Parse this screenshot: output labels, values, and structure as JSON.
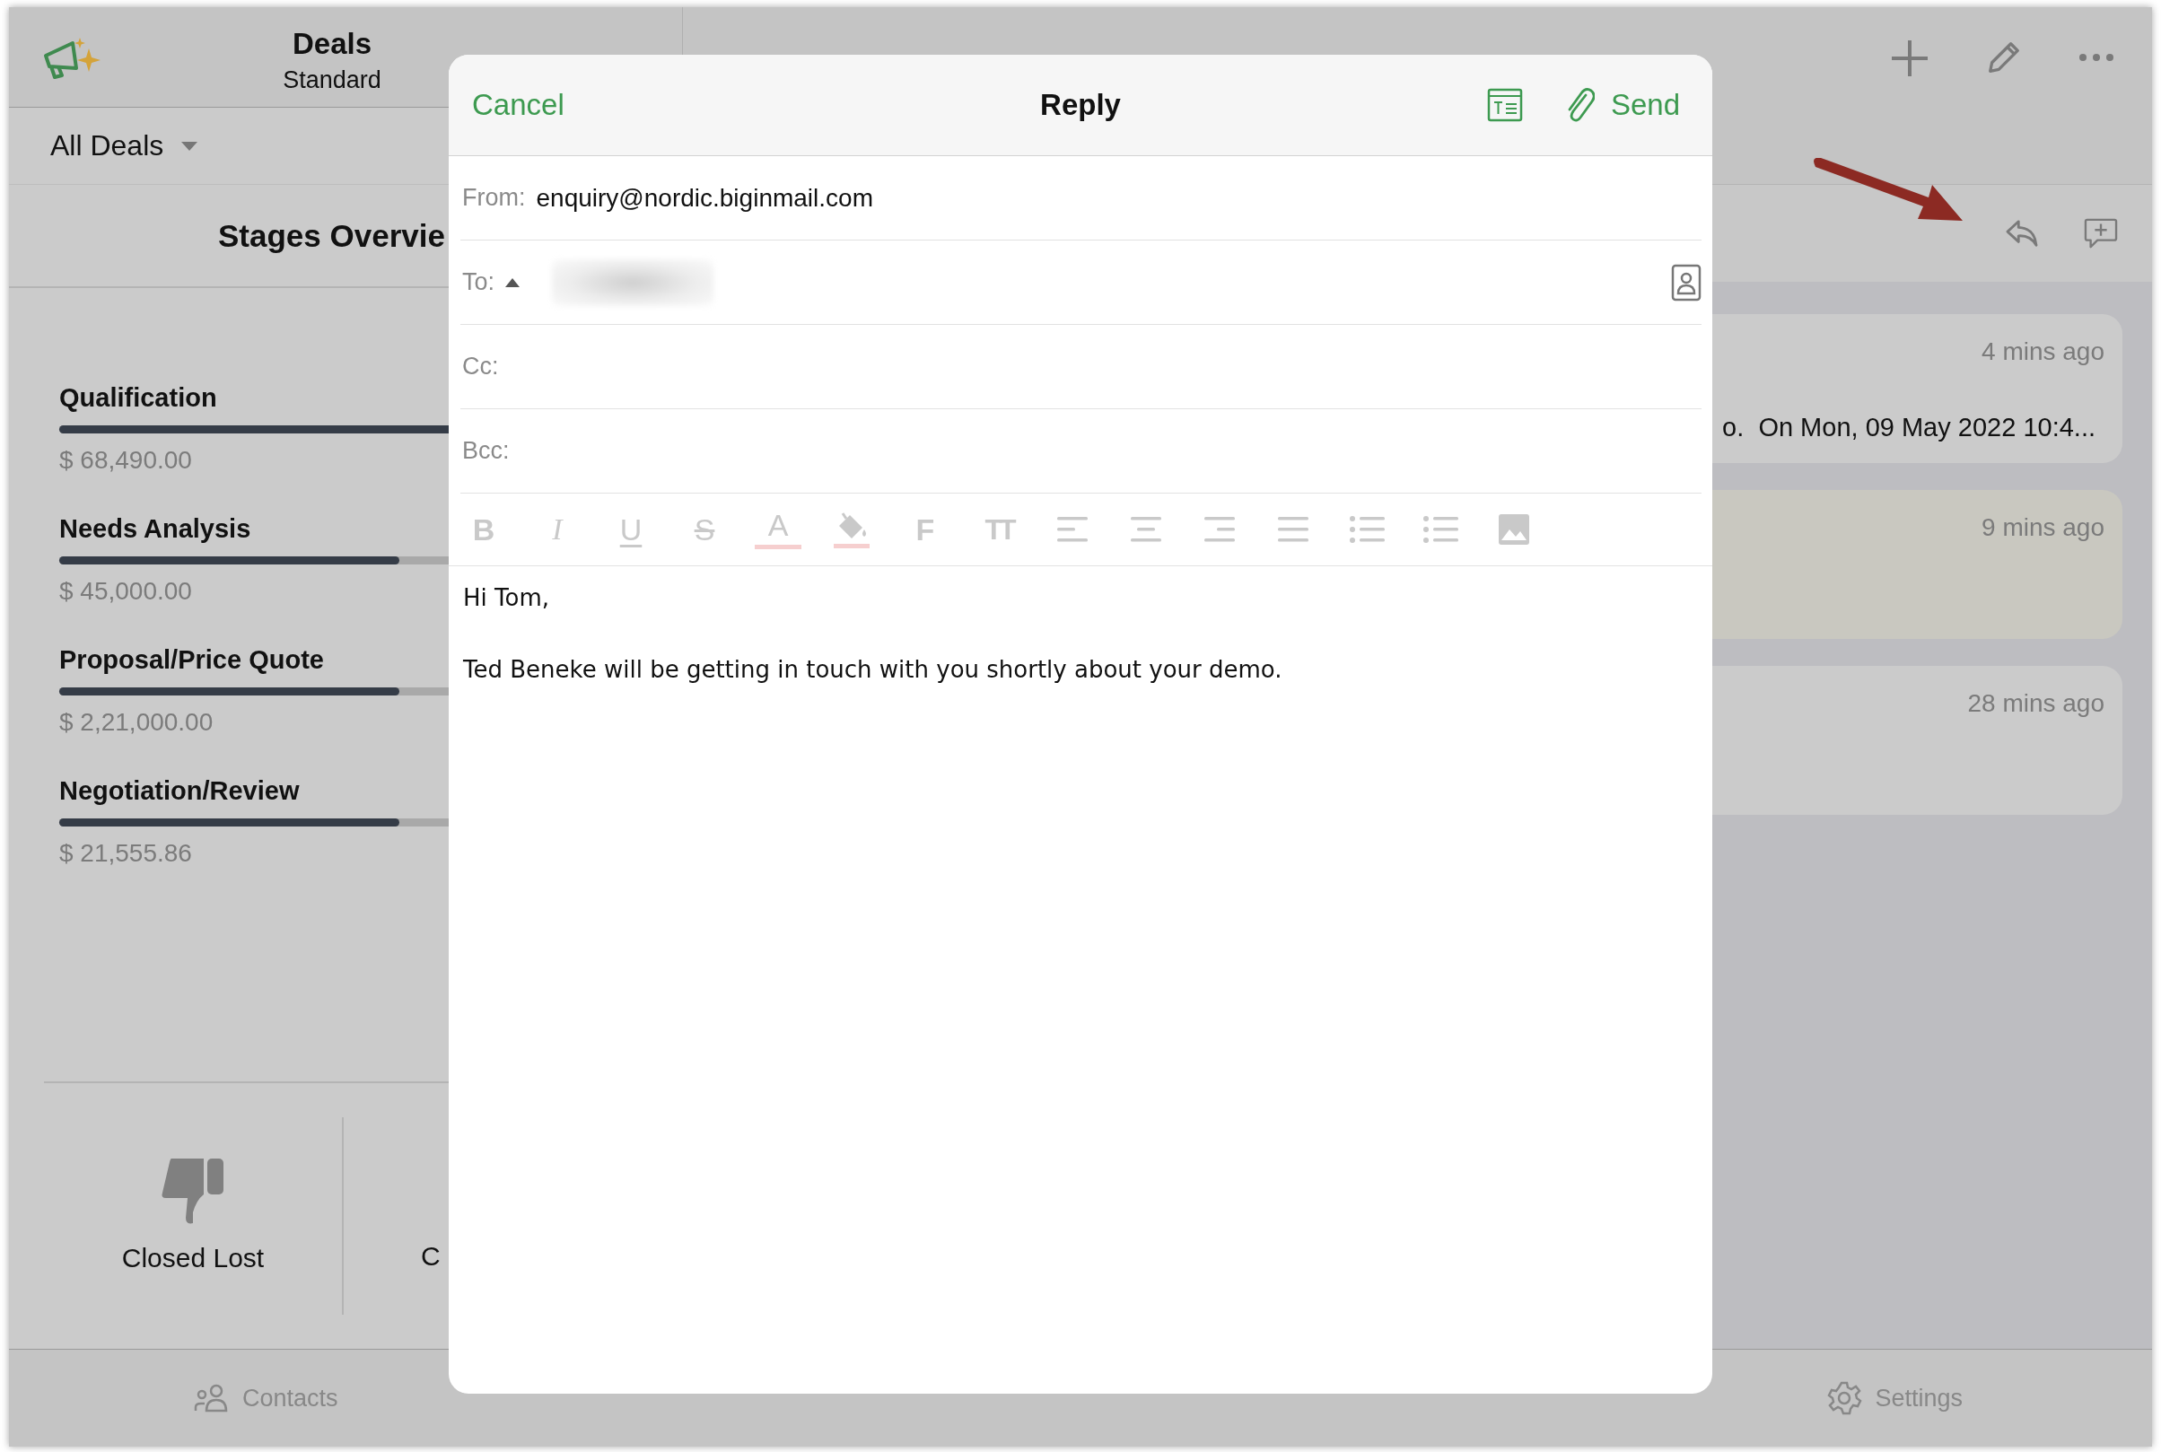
{
  "sidebar": {
    "title": "Deals",
    "subtitle": "Standard",
    "filter": "All Deals",
    "section_title": "Stages Overvie",
    "stages": [
      {
        "name": "Qualification",
        "level": 1,
        "amount": "$ 68,490.00"
      },
      {
        "name": "Needs Analysis",
        "level": 0.58,
        "amount": "$ 45,000.00"
      },
      {
        "name": "Proposal/Price Quote",
        "level": 0.58,
        "amount": "$ 2,21,000.00"
      },
      {
        "name": "Negotiation/Review",
        "level": 0.58,
        "amount": "$ 21,555.86"
      }
    ],
    "outcomes": [
      {
        "label": "Closed Lost",
        "kind": "lost"
      },
      {
        "label": "C"
      }
    ]
  },
  "timeline": {
    "cards": [
      {
        "time": "4 mins ago",
        "snippet": "o.  On Mon, 09 May 2022 10:4...",
        "color": "#cbcbcb"
      },
      {
        "time": "9 mins ago",
        "color": "#c9c8c0"
      },
      {
        "time": "28 mins ago",
        "color": "#cbcbcb"
      }
    ]
  },
  "tab_bar": [
    {
      "label": "Contacts",
      "kind": "contacts"
    },
    {
      "label": "Settings",
      "kind": "settings"
    }
  ],
  "reply_dialog": {
    "cancel": "Cancel",
    "title": "Reply",
    "send": "Send",
    "fields": [
      {
        "label": "From:",
        "kind": "text",
        "value": "enquiry@nordic.biginmail.com"
      },
      {
        "label": "To:",
        "kind": "recipients"
      },
      {
        "label": "Cc:",
        "kind": "empty"
      },
      {
        "label": "Bcc:",
        "kind": "empty"
      }
    ],
    "toolbar": {
      "disabled": true,
      "items": [
        {
          "kind": "bold",
          "text": "B"
        },
        {
          "kind": "italic",
          "text": "I"
        },
        {
          "kind": "underline",
          "text": "U"
        },
        {
          "kind": "strike",
          "text": "S"
        },
        {
          "kind": "text-color",
          "text": "A"
        },
        {
          "kind": "fill-color"
        },
        {
          "kind": "font",
          "text": "F"
        },
        {
          "kind": "text-size",
          "text": "TT"
        },
        {
          "kind": "align-left"
        },
        {
          "kind": "align-center"
        },
        {
          "kind": "align-right"
        },
        {
          "kind": "justify"
        },
        {
          "kind": "numbered-list"
        },
        {
          "kind": "bulleted-list"
        },
        {
          "kind": "image"
        }
      ]
    },
    "body": [
      "Hi Tom,",
      "Ted Beneke will be getting in touch with you shortly about your demo."
    ]
  }
}
